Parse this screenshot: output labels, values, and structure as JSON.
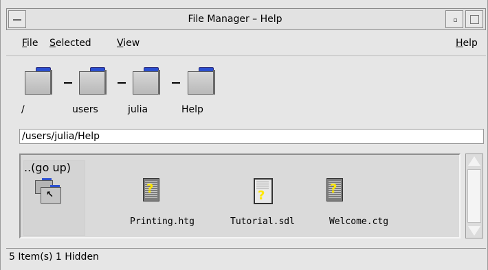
{
  "window": {
    "title": "File Manager – Help"
  },
  "menubar": {
    "file": {
      "mnemonic": "F",
      "rest": "ile"
    },
    "selected": {
      "mnemonic": "S",
      "rest": "elected"
    },
    "view": {
      "mnemonic": "V",
      "rest": "iew"
    },
    "help": {
      "mnemonic": "H",
      "rest": "elp"
    }
  },
  "path_icons": [
    "/",
    "users",
    "julia",
    "Help"
  ],
  "path_field": {
    "value": "/users/julia/Help"
  },
  "items": [
    {
      "label": "..(go up)",
      "icon": "go-up-folder-icon"
    },
    {
      "label": "Printing.htg",
      "icon": "help-document-icon"
    },
    {
      "label": "Tutorial.sdl",
      "icon": "sdl-document-icon"
    },
    {
      "label": "Welcome.ctg",
      "icon": "help-document-icon"
    }
  ],
  "status": {
    "text": "5 Item(s) 1 Hidden"
  },
  "colors": {
    "folder_tab": "#2b4fd0",
    "doc_mark": "#ffe800",
    "window_bg": "#e6e6e6"
  }
}
